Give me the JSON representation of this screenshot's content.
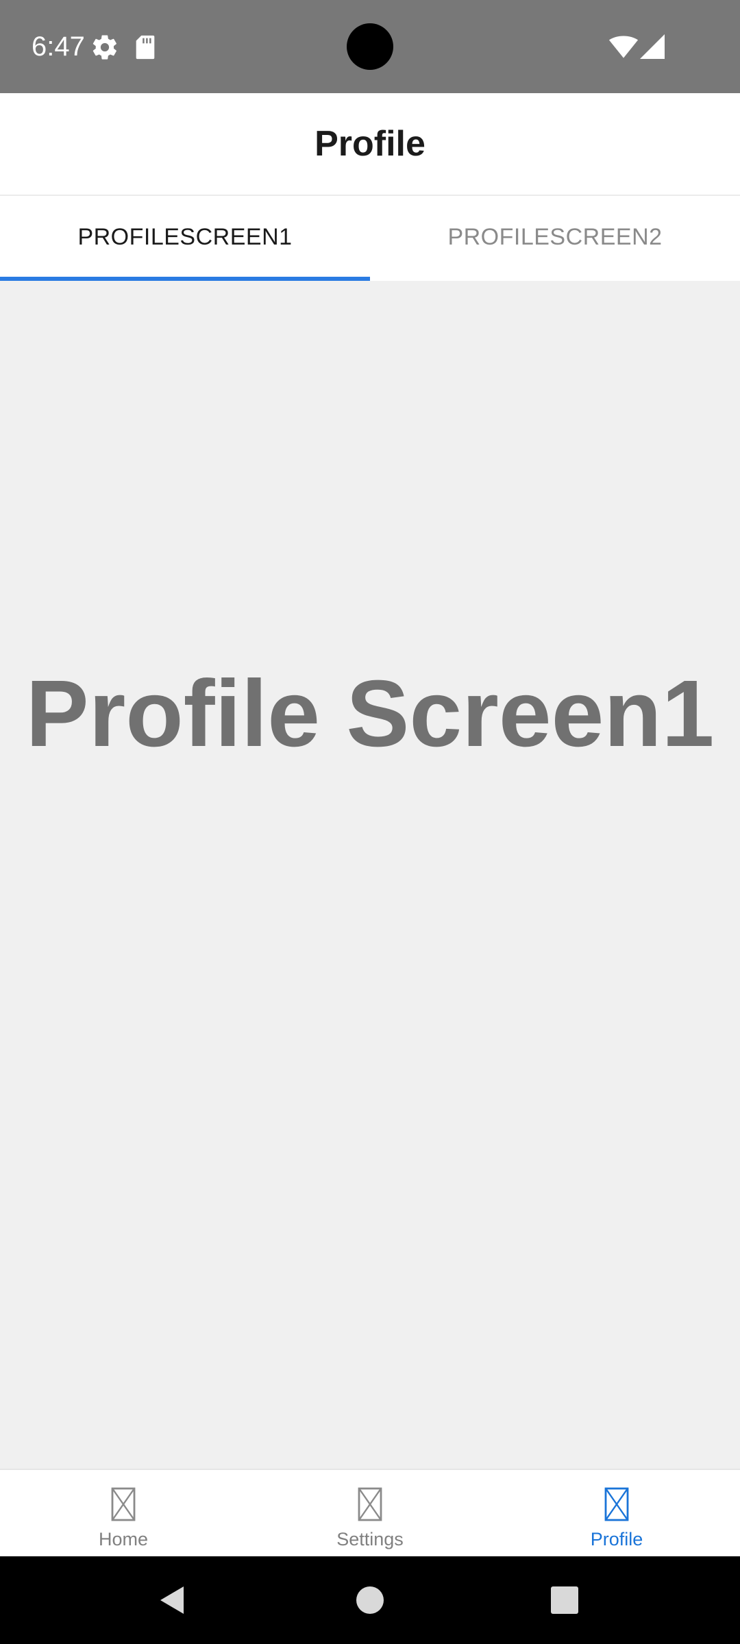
{
  "status_bar": {
    "time": "6:47",
    "icons": [
      "settings-gear-icon",
      "sd-card-icon",
      "wifi-icon",
      "cell-signal-icon"
    ]
  },
  "header": {
    "title": "Profile"
  },
  "tabs": [
    {
      "label": "PROFILESCREEN1",
      "selected": true
    },
    {
      "label": "PROFILESCREEN2",
      "selected": false
    }
  ],
  "main": {
    "heading": "Profile Screen1"
  },
  "bottom_nav": {
    "items": [
      {
        "label": "Home",
        "icon": "placeholder-icon",
        "active": false
      },
      {
        "label": "Settings",
        "icon": "placeholder-icon",
        "active": false
      },
      {
        "label": "Profile",
        "icon": "placeholder-icon",
        "active": true
      }
    ]
  },
  "system_nav": {
    "buttons": [
      "back-icon",
      "home-circle-icon",
      "recents-square-icon"
    ]
  },
  "colors": {
    "status_bar": "#787878",
    "accent": "#2a7be2",
    "active_nav": "#1a74d8",
    "content_background": "#f0f0f0",
    "heading_text": "#717171"
  }
}
